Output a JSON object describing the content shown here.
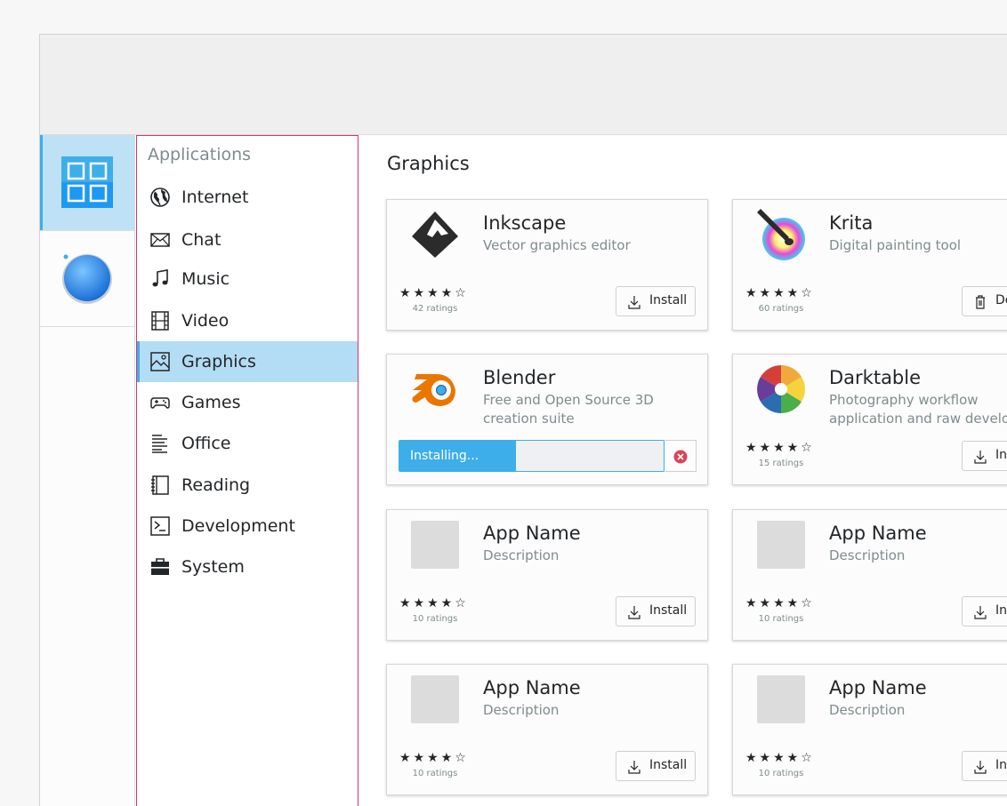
{
  "sidebar": {
    "heading": "Applications",
    "categories": [
      {
        "label": "Internet",
        "icon": "globe-icon"
      },
      {
        "label": "Chat",
        "icon": "envelope-icon"
      },
      {
        "label": "Music",
        "icon": "music-note-icon"
      },
      {
        "label": "Video",
        "icon": "film-icon"
      },
      {
        "label": "Graphics",
        "icon": "image-icon",
        "active": true
      },
      {
        "label": "Games",
        "icon": "gamepad-icon"
      },
      {
        "label": "Office",
        "icon": "text-lines-icon"
      },
      {
        "label": "Reading",
        "icon": "notebook-icon"
      },
      {
        "label": "Development",
        "icon": "terminal-icon"
      },
      {
        "label": "System",
        "icon": "toolbox-icon"
      }
    ]
  },
  "content": {
    "title": "Graphics",
    "apps": [
      {
        "name": "Inkscape",
        "description": "Vector graphics editor",
        "stars": "★★★★☆",
        "rating_value": 4,
        "ratings": "42 ratings",
        "action": "Install"
      },
      {
        "name": "Krita",
        "description": "Digital painting tool",
        "stars": "★★★★☆",
        "rating_value": 4,
        "ratings": "60 ratings",
        "action": "De"
      },
      {
        "name": "Blender",
        "description": "Free and Open Source 3D creation suite",
        "progress_label": "Installing...",
        "progress": 0.44
      },
      {
        "name": "Darktable",
        "description": "Photography workflow application and raw develop",
        "stars": "★★★★☆",
        "rating_value": 4,
        "ratings": "15 ratings",
        "action": "Ins"
      },
      {
        "name": "App Name",
        "description": "Description",
        "stars": "★★★★☆",
        "rating_value": 4,
        "ratings": "10 ratings",
        "action": "Install"
      },
      {
        "name": "App Name",
        "description": "Description",
        "stars": "★★★★☆",
        "rating_value": 4,
        "ratings": "10 ratings",
        "action": "Ins"
      },
      {
        "name": "App Name",
        "description": "Description",
        "stars": "★★★★☆",
        "rating_value": 4,
        "ratings": "10 ratings",
        "action": "Install"
      },
      {
        "name": "App Name",
        "description": "Description",
        "stars": "★★★★☆",
        "rating_value": 4,
        "ratings": "10 ratings",
        "action": "Ins"
      }
    ]
  },
  "colors": {
    "accent": "#3daee9",
    "selection": "#b3dcf5",
    "sidebar_border": "#d5356e",
    "cancel": "#da4453"
  }
}
